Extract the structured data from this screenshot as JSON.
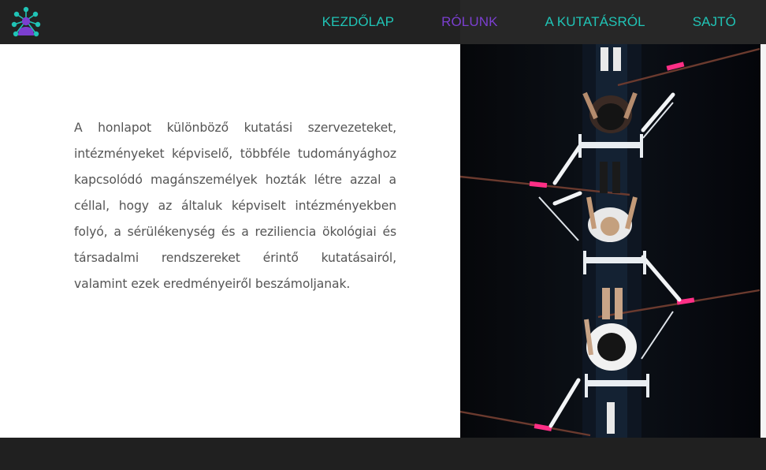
{
  "nav": {
    "logo_icon": "team-network-logo-icon",
    "links": [
      {
        "label": "KEZDŐLAP",
        "active": false
      },
      {
        "label": "RÓLUNK",
        "active": true
      },
      {
        "label": "A KUTATÁSRÓL",
        "active": false
      },
      {
        "label": "SAJTÓ",
        "active": false
      }
    ]
  },
  "about": {
    "text": "A honlapot különböző kutatási szervezeteket, intézményeket képviselő, többféle tudományághoz kapcsolódó magánszemélyek hozták létre azzal a céllal, hogy az általuk képviselt intézményekben folyó, a sérülékenység és a reziliencia ökológiai és társadalmi rendszereket érintő kutatásairól, valamint ezek eredményeiről beszámoljanak."
  },
  "photo": {
    "subject": "rowing-team-aerial-photo"
  },
  "colors": {
    "accent_teal": "#20c4b6",
    "accent_purple": "#7b3fd0",
    "navbar_bg": "#222222",
    "footer_bg": "#202020"
  }
}
